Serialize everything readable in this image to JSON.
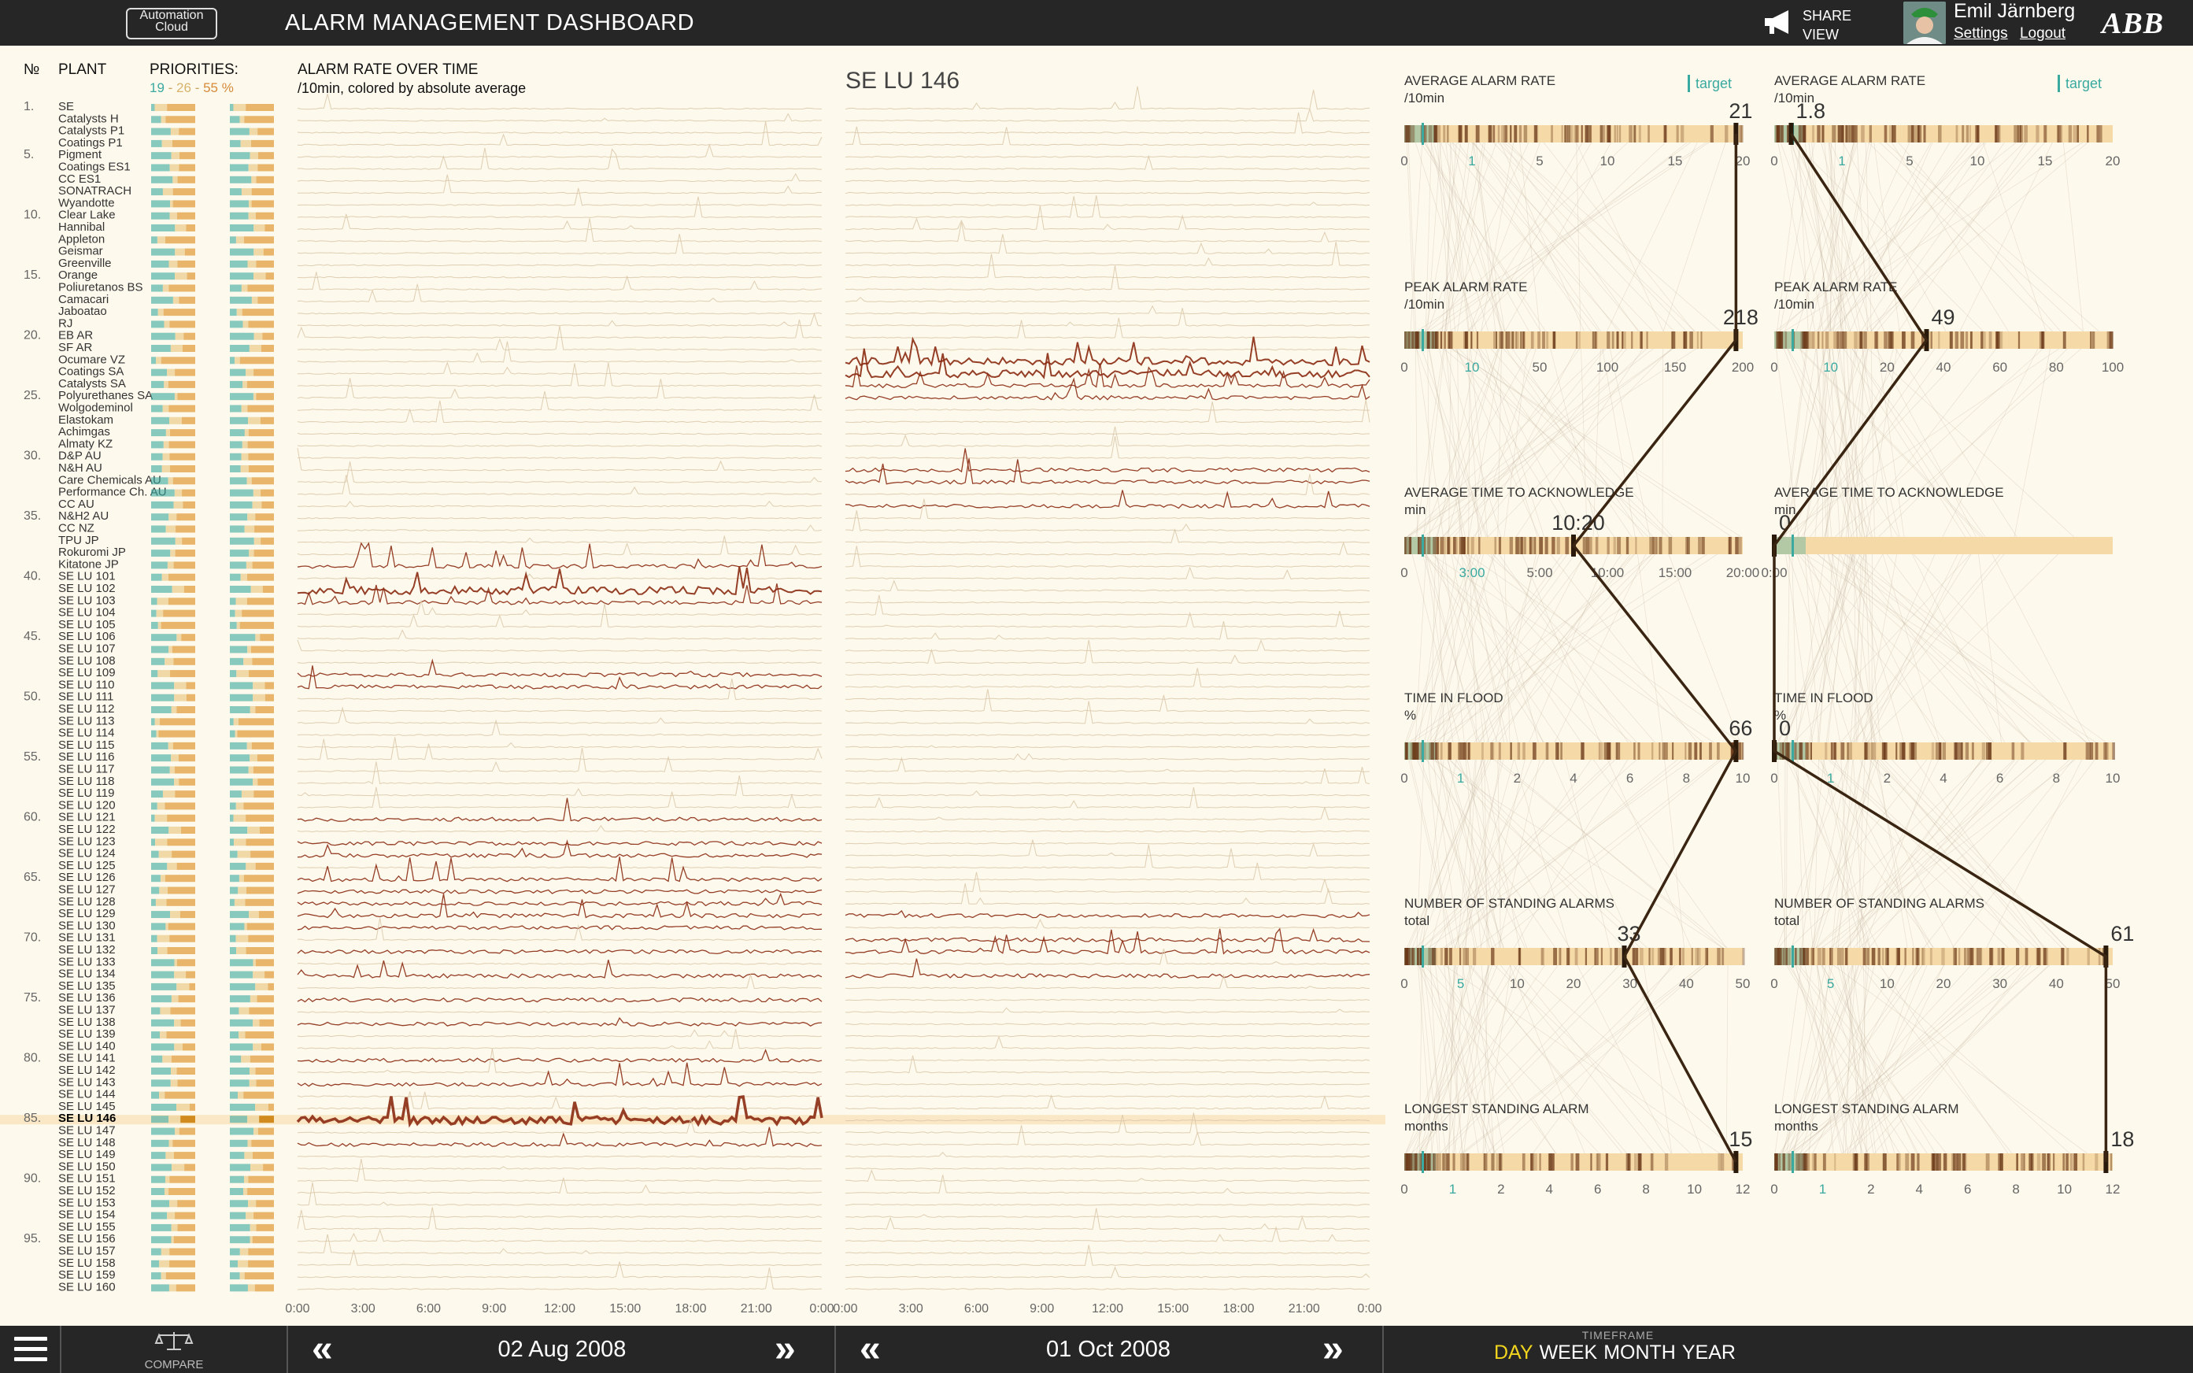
{
  "header": {
    "logo_line1": "Automation",
    "logo_line2": "Cloud",
    "title": "ALARM MANAGEMENT DASHBOARD",
    "share_line1": "SHARE",
    "share_line2": "VIEW",
    "user_name": "Emil Järnberg",
    "settings_label": "Settings",
    "logout_label": "Logout",
    "brand": "ABB"
  },
  "columns": {
    "number": "№",
    "plant": "PLANT",
    "priorities": "PRIORITIES:",
    "prio_low": "19",
    "prio_mid": "26",
    "prio_high": "55 %",
    "rate_title": "ALARM RATE OVER TIME",
    "rate_subtitle": "/10min, colored by absolute average",
    "detail_title": "SE LU 146"
  },
  "plants": [
    "SE",
    "Catalysts H",
    "Catalysts P1",
    "Coatings P1",
    "Pigment",
    "Coatings ES1",
    "CC ES1",
    "SONATRACH",
    "Wyandotte",
    "Clear Lake",
    "Hannibal",
    "Appleton",
    "Geismar",
    "Greenville",
    "Orange",
    "Poliuretanos BS",
    "Camacari",
    "Jaboatao",
    "RJ",
    "EB AR",
    "SF AR",
    "Ocumare VZ",
    "Coatings SA",
    "Catalysts SA",
    "Polyurethanes SA",
    "Wolgodeminol",
    "Elastokam",
    "Achimgas",
    "Almaty KZ",
    "D&P AU",
    "N&H AU",
    "Care Chemicals AU",
    "Performance Ch. AU",
    "CC AU",
    "N&H2 AU",
    "CC NZ",
    "TPU JP",
    "Rokuromi JP",
    "Kitatone JP",
    "SE LU 101",
    "SE LU 102",
    "SE LU 103",
    "SE LU 104",
    "SE LU 105",
    "SE LU 106",
    "SE LU 107",
    "SE LU 108",
    "SE LU 109",
    "SE LU 110",
    "SE LU 111",
    "SE LU 112",
    "SE LU 113",
    "SE LU 114",
    "SE LU 115",
    "SE LU 116",
    "SE LU 117",
    "SE LU 118",
    "SE LU 119",
    "SE LU 120",
    "SE LU 121",
    "SE LU 122",
    "SE LU 123",
    "SE LU 124",
    "SE LU 125",
    "SE LU 126",
    "SE LU 127",
    "SE LU 128",
    "SE LU 129",
    "SE LU 130",
    "SE LU 131",
    "SE LU 132",
    "SE LU 133",
    "SE LU 134",
    "SE LU 135",
    "SE LU 136",
    "SE LU 137",
    "SE LU 138",
    "SE LU 139",
    "SE LU 140",
    "SE LU 141",
    "SE LU 142",
    "SE LU 143",
    "SE LU 144",
    "SE LU 145",
    "SE LU 146",
    "SE LU 147",
    "SE LU 148",
    "SE LU 149",
    "SE LU 150",
    "SE LU 151",
    "SE LU 152",
    "SE LU 153",
    "SE LU 154",
    "SE LU 155",
    "SE LU 156",
    "SE LU 157",
    "SE LU 158",
    "SE LU 159",
    "SE LU 160"
  ],
  "row_numbers": [
    "1.",
    "5.",
    "10.",
    "15.",
    "20.",
    "25.",
    "30.",
    "35.",
    "40.",
    "45.",
    "50.",
    "55.",
    "60.",
    "65.",
    "70.",
    "75.",
    "80.",
    "85.",
    "90.",
    "95."
  ],
  "selected_plant": "SE LU 146",
  "time_ticks": [
    "0:00",
    "3:00",
    "6:00",
    "9:00",
    "12:00",
    "15:00",
    "18:00",
    "21:00",
    "0:00"
  ],
  "target_label": "target",
  "metrics_left": [
    {
      "title": "AVERAGE ALARM RATE",
      "unit": "/10min",
      "value": "21",
      "ticks": [
        "0",
        "1",
        "5",
        "10",
        "15",
        "20"
      ],
      "target": true
    },
    {
      "title": "PEAK ALARM RATE",
      "unit": "/10min",
      "value": "218",
      "ticks": [
        "0",
        "10",
        "50",
        "100",
        "150",
        "200"
      ]
    },
    {
      "title": "AVERAGE TIME TO ACKNOWLEDGE",
      "unit": "min",
      "value": "10:20",
      "ticks": [
        "0",
        "3:00",
        "5:00",
        "10:00",
        "15:00",
        "20:00"
      ]
    },
    {
      "title": "TIME IN FLOOD",
      "unit": "%",
      "value": "66",
      "ticks": [
        "0",
        "1",
        "2",
        "4",
        "6",
        "8",
        "10"
      ]
    },
    {
      "title": "NUMBER OF STANDING ALARMS",
      "unit": "total",
      "value": "33",
      "ticks": [
        "0",
        "5",
        "10",
        "20",
        "30",
        "40",
        "50"
      ]
    },
    {
      "title": "LONGEST STANDING ALARM",
      "unit": "months",
      "value": "15",
      "ticks": [
        "0",
        "1",
        "2",
        "4",
        "6",
        "8",
        "10",
        "12"
      ]
    }
  ],
  "metrics_right": [
    {
      "title": "AVERAGE ALARM RATE",
      "unit": "/10min",
      "value": "1.8",
      "ticks": [
        "0",
        "1",
        "5",
        "10",
        "15",
        "20"
      ],
      "target": true
    },
    {
      "title": "PEAK ALARM RATE",
      "unit": "/10min",
      "value": "49",
      "ticks": [
        "0",
        "10",
        "20",
        "40",
        "60",
        "80",
        "100"
      ]
    },
    {
      "title": "AVERAGE TIME TO ACKNOWLEDGE",
      "unit": "min",
      "value": "0",
      "ticks": [
        "0:00"
      ]
    },
    {
      "title": "TIME IN FLOOD",
      "unit": "%",
      "value": "0",
      "ticks": [
        "0",
        "1",
        "2",
        "4",
        "6",
        "8",
        "10"
      ]
    },
    {
      "title": "NUMBER OF STANDING ALARMS",
      "unit": "total",
      "value": "61",
      "ticks": [
        "0",
        "5",
        "10",
        "20",
        "30",
        "40",
        "50"
      ]
    },
    {
      "title": "LONGEST STANDING ALARM",
      "unit": "months",
      "value": "18",
      "ticks": [
        "0",
        "1",
        "2",
        "4",
        "6",
        "8",
        "10",
        "12"
      ]
    }
  ],
  "footer": {
    "compare_label": "COMPARE",
    "date_left": "02 Aug 2008",
    "date_right": "01 Oct 2008",
    "timeframe_label": "TIMEFRAME",
    "timeframe_options": [
      "DAY",
      "WEEK",
      "MONTH",
      "YEAR"
    ],
    "timeframe_active": "DAY"
  },
  "colors": {
    "background": "#fdf9ec",
    "bar": "#262626",
    "accent_teal": "#3aa9a0",
    "line_light": "#d9c7a8",
    "line_dark": "#8b2a12",
    "band": "#f5d9a6",
    "active_timeframe": "#f2d51e"
  }
}
